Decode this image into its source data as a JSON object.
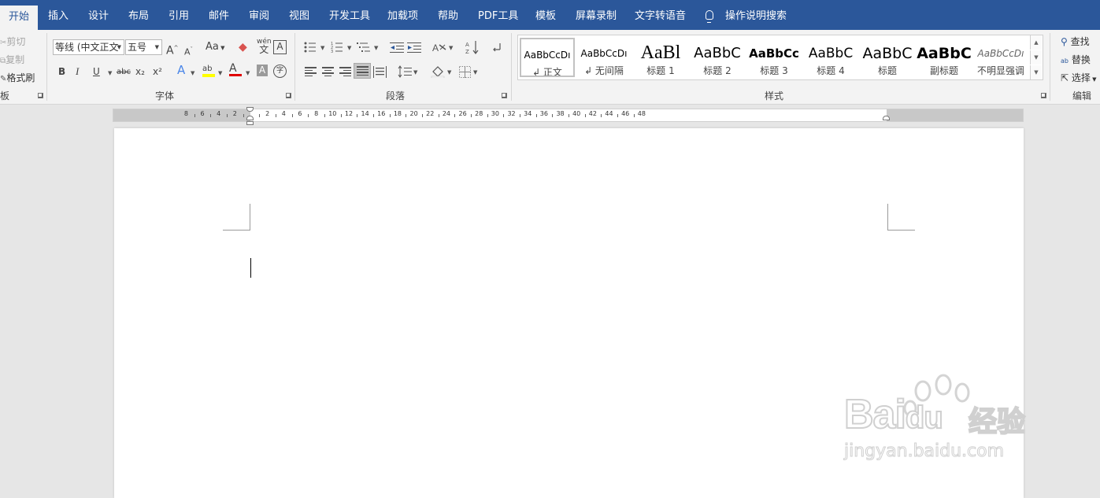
{
  "tabs": {
    "home": "开始",
    "insert": "插入",
    "design": "设计",
    "layout": "布局",
    "references": "引用",
    "mailings": "邮件",
    "review": "审阅",
    "view": "视图",
    "developer": "开发工具",
    "addins": "加载项",
    "help": "帮助",
    "pdf": "PDF工具",
    "template": "模板",
    "screen_record": "屏幕录制",
    "tts": "文字转语音",
    "tell_me": "操作说明搜索"
  },
  "clipboard": {
    "cut": "剪切",
    "copy": "复制",
    "format_painter": "格式刷",
    "group_label": "板"
  },
  "font": {
    "font_name": "等线 (中文正文",
    "font_size": "五号",
    "grow": "A",
    "shrink": "A",
    "change_case": "Aa",
    "phonetic": "wén",
    "border_char": "A",
    "bold": "B",
    "italic": "I",
    "underline": "U",
    "strikethrough": "abc",
    "subscript": "x₂",
    "superscript": "x²",
    "text_effects": "A",
    "highlight": "ab",
    "font_color": "A",
    "char_shading": "A",
    "enclose": "字",
    "group_label": "字体"
  },
  "paragraph": {
    "group_label": "段落"
  },
  "styles": {
    "group_label": "样式",
    "items": [
      {
        "sample": "AaBbCcDı",
        "name": "↲ 正文"
      },
      {
        "sample": "AaBbCcDı",
        "name": "↲ 无间隔"
      },
      {
        "sample": "AaBl",
        "name": "标题 1"
      },
      {
        "sample": "AaBbC",
        "name": "标题 2"
      },
      {
        "sample": "AaBbCc",
        "name": "标题 3"
      },
      {
        "sample": "AaBbC",
        "name": "标题 4"
      },
      {
        "sample": "AaBbC",
        "name": "标题"
      },
      {
        "sample": "AaBbC",
        "name": "副标题"
      },
      {
        "sample": "AaBbCcDı",
        "name": "不明显强调"
      }
    ]
  },
  "editing": {
    "find": "查找",
    "replace": "替换",
    "select": "选择",
    "group_label": "编辑"
  },
  "ruler": {
    "left_numbers": [
      "8",
      "6",
      "4",
      "2"
    ],
    "right_numbers": [
      "2",
      "4",
      "6",
      "8",
      "10",
      "12",
      "14",
      "16",
      "18",
      "20",
      "22",
      "24",
      "26",
      "28",
      "30",
      "32",
      "34",
      "36",
      "38",
      "40",
      "42",
      "44",
      "46",
      "48"
    ]
  },
  "watermark": {
    "brand": "Bai",
    "brand_du": "du",
    "cn": "经验",
    "url": "jingyan.baidu.com"
  },
  "colors": {
    "tab_bar": "#2b579a",
    "ribbon": "#f3f3f3",
    "highlight_yellow": "#ffff00",
    "font_red": "#e00000"
  }
}
